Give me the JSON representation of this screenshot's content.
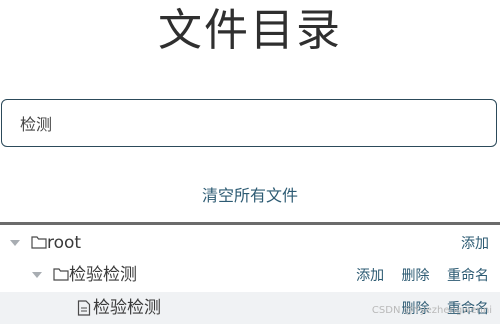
{
  "title": "文件目录",
  "search": {
    "value": "检测",
    "placeholder": ""
  },
  "clear_button": "清空所有文件",
  "tree": {
    "root": {
      "label": "root",
      "actions": {
        "add": "添加"
      }
    },
    "folder": {
      "label": "检验检测",
      "actions": {
        "add": "添加",
        "delete": "删除",
        "rename": "重命名"
      }
    },
    "file": {
      "label": "检验检测",
      "actions": {
        "delete": "删除",
        "rename": "重命名"
      }
    }
  },
  "watermark": "CSDN @Yyezhengwenni",
  "colors": {
    "link": "#2d5b73",
    "title": "#2f2f2f",
    "border": "#2c4a5a",
    "highlight_row": "#f0f2f4"
  }
}
